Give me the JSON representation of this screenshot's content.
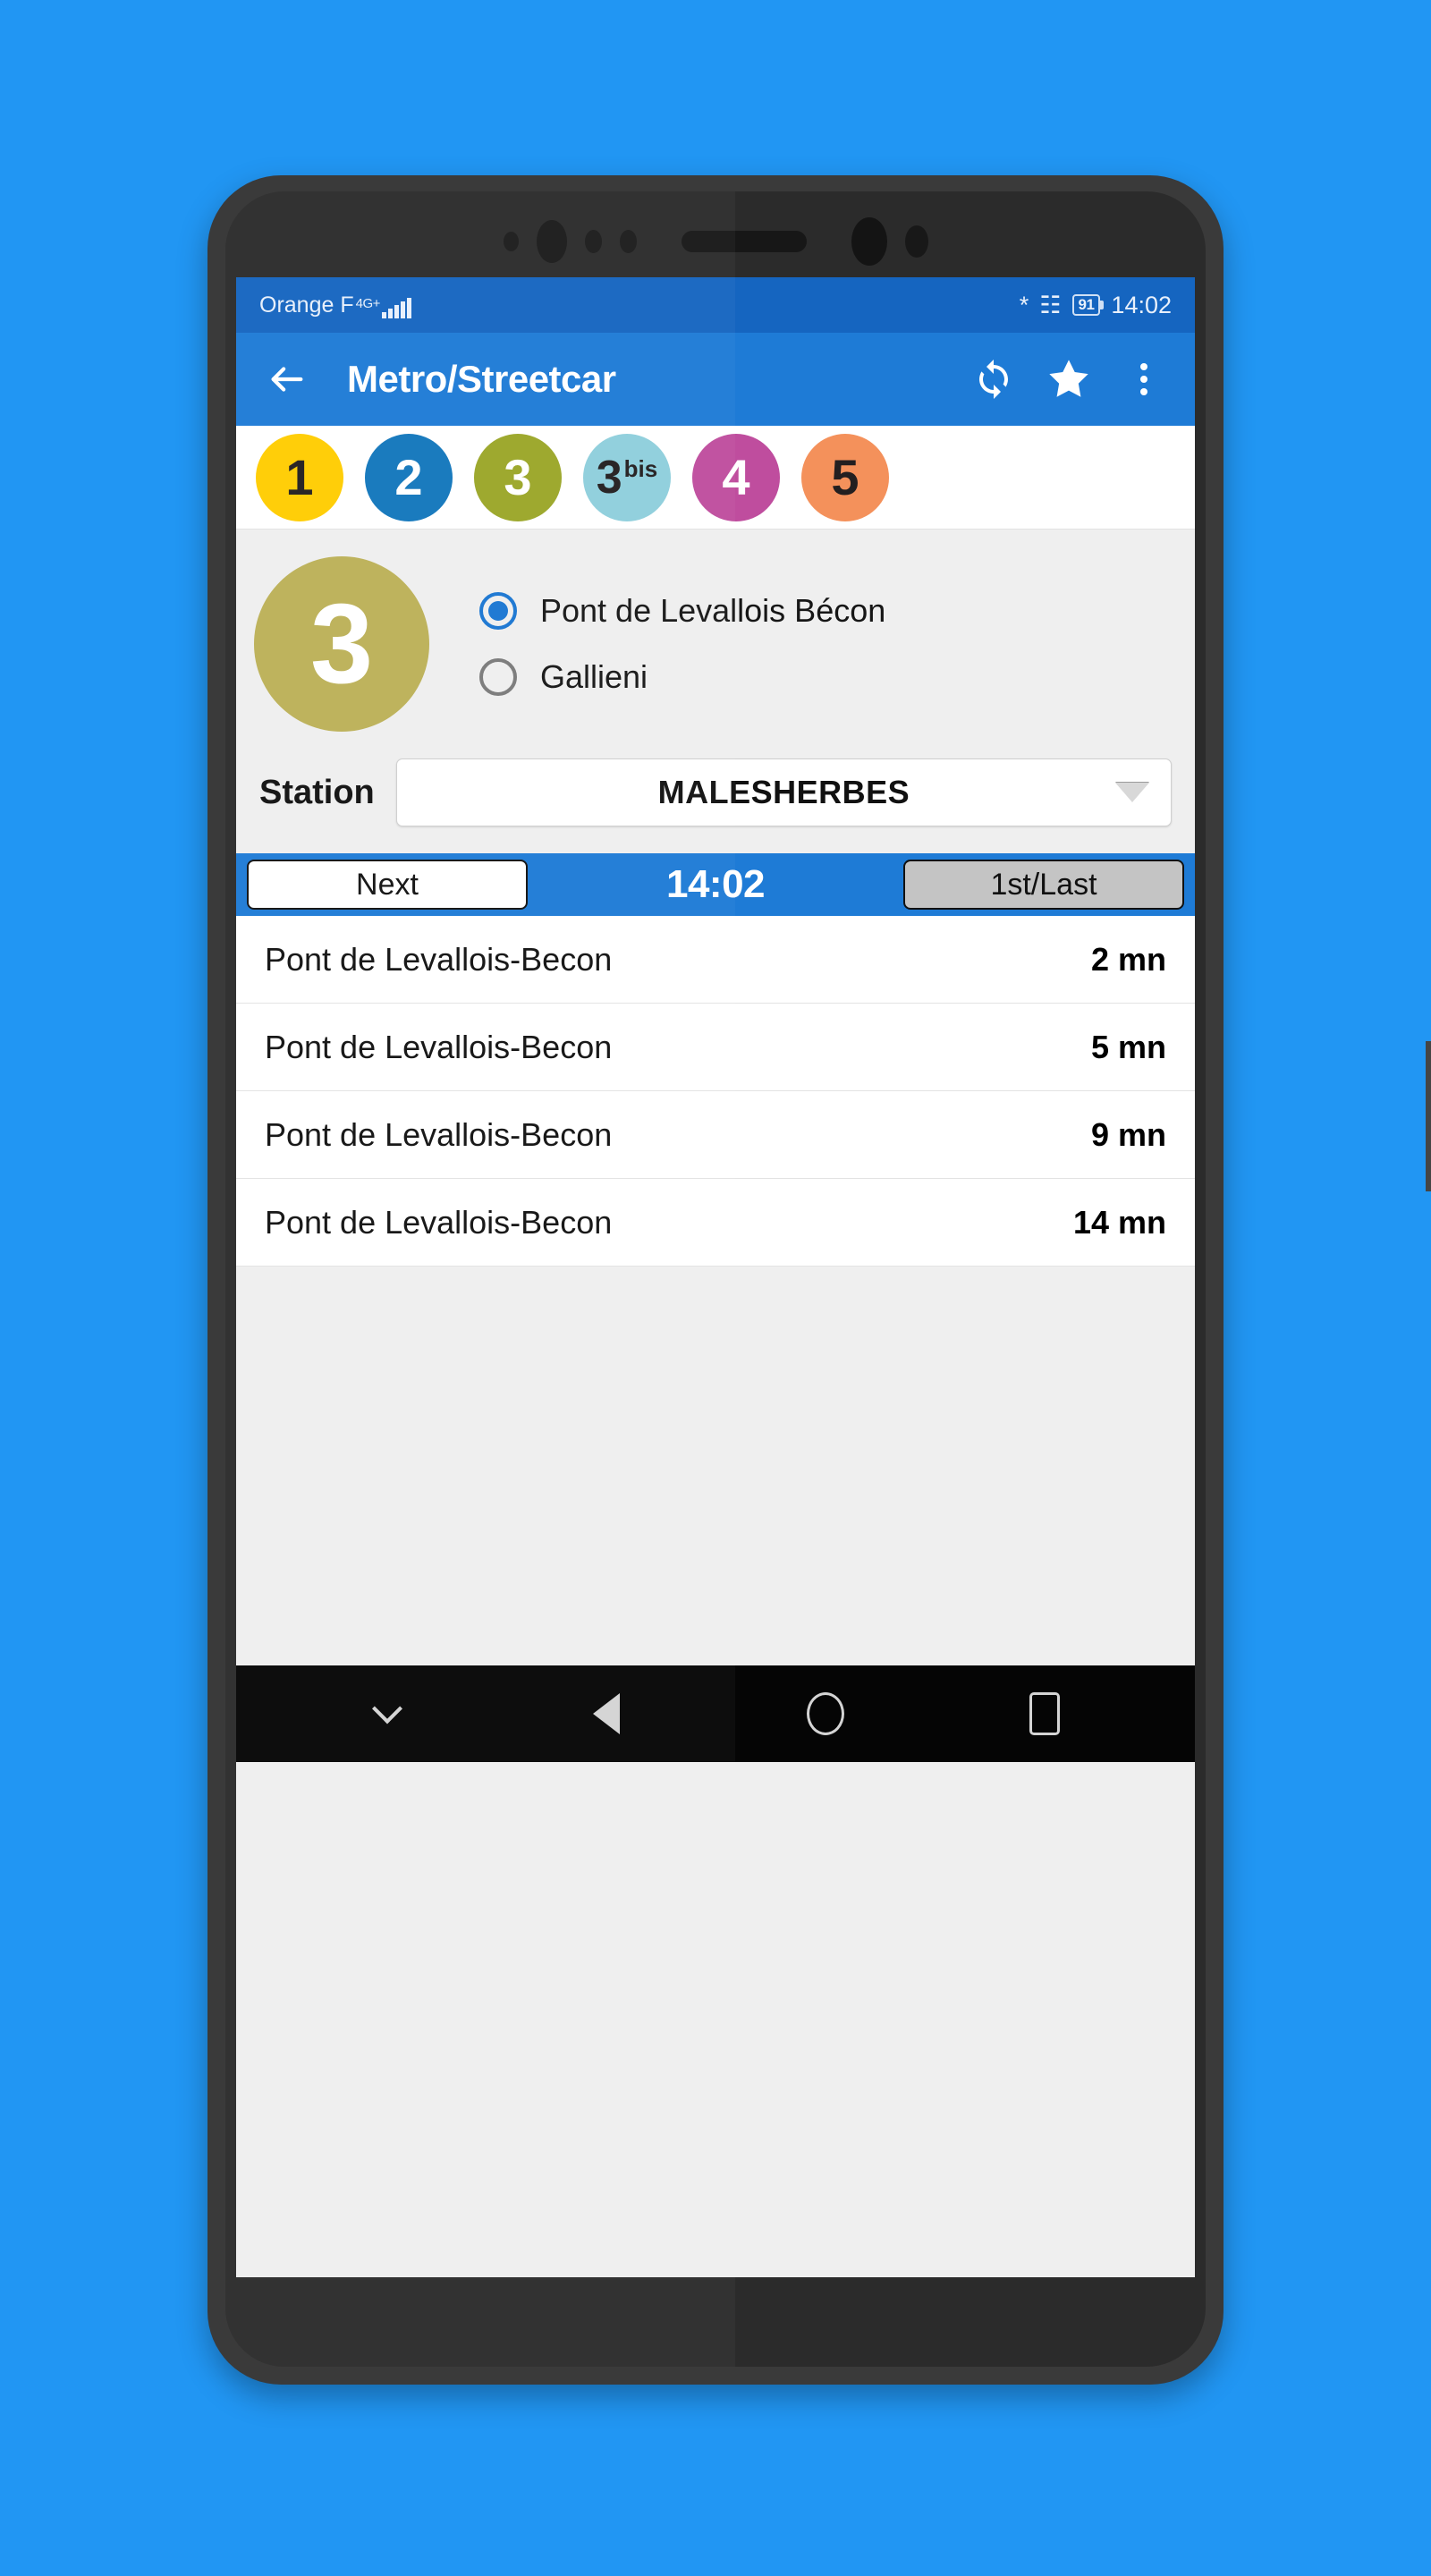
{
  "theme": {
    "wallpaper": "#2196F3",
    "appbar": "#1E7BD6",
    "statusbar": "#1565C0",
    "accent": "#1976D2",
    "surface": "#EFEFEF"
  },
  "statusbar": {
    "carrier": "Orange F",
    "network": "4G+",
    "battery": "91",
    "time": "14:02",
    "icons": [
      "bluetooth-icon",
      "vibrate-icon",
      "battery-icon"
    ]
  },
  "appbar": {
    "back_icon": "back-arrow-icon",
    "title": "Metro/Streetcar",
    "refresh_icon": "sync-icon",
    "favorite_icon": "star-icon",
    "overflow_icon": "overflow-menu-icon"
  },
  "lines": [
    {
      "label": "1",
      "suffix": "",
      "bg": "#FFCD00",
      "fg": "#231f20"
    },
    {
      "label": "2",
      "suffix": "",
      "bg": "#1277BC",
      "fg": "#ffffff"
    },
    {
      "label": "3",
      "suffix": "",
      "bg": "#9BA628",
      "fg": "#ffffff"
    },
    {
      "label": "3",
      "suffix": "bis",
      "bg": "#8FCFDC",
      "fg": "#231f20"
    },
    {
      "label": "4",
      "suffix": "",
      "bg": "#BF4D9E",
      "fg": "#ffffff"
    },
    {
      "label": "5",
      "suffix": "",
      "bg": "#F4915B",
      "fg": "#231f20"
    }
  ],
  "selected_line": {
    "label": "3",
    "bg": "#BCB158",
    "fg": "#ffffff"
  },
  "directions": [
    {
      "label": "Pont de Levallois Bécon",
      "selected": true
    },
    {
      "label": "Gallieni",
      "selected": false
    }
  ],
  "station": {
    "label": "Station",
    "value": "MALESHERBES",
    "caret_icon": "dropdown-caret-icon"
  },
  "tabs": {
    "next_label": "Next",
    "clock": "14:02",
    "first_last_label": "1st/Last"
  },
  "departures": [
    {
      "destination": "Pont de Levallois-Becon",
      "eta": "2 mn"
    },
    {
      "destination": "Pont de Levallois-Becon",
      "eta": "5 mn"
    },
    {
      "destination": "Pont de Levallois-Becon",
      "eta": "9 mn"
    },
    {
      "destination": "Pont de Levallois-Becon",
      "eta": "14 mn"
    }
  ],
  "navbar": {
    "hide_icon": "chevron-down-icon",
    "back_icon": "nav-back-icon",
    "home_icon": "nav-home-icon",
    "recents_icon": "nav-recents-icon"
  }
}
